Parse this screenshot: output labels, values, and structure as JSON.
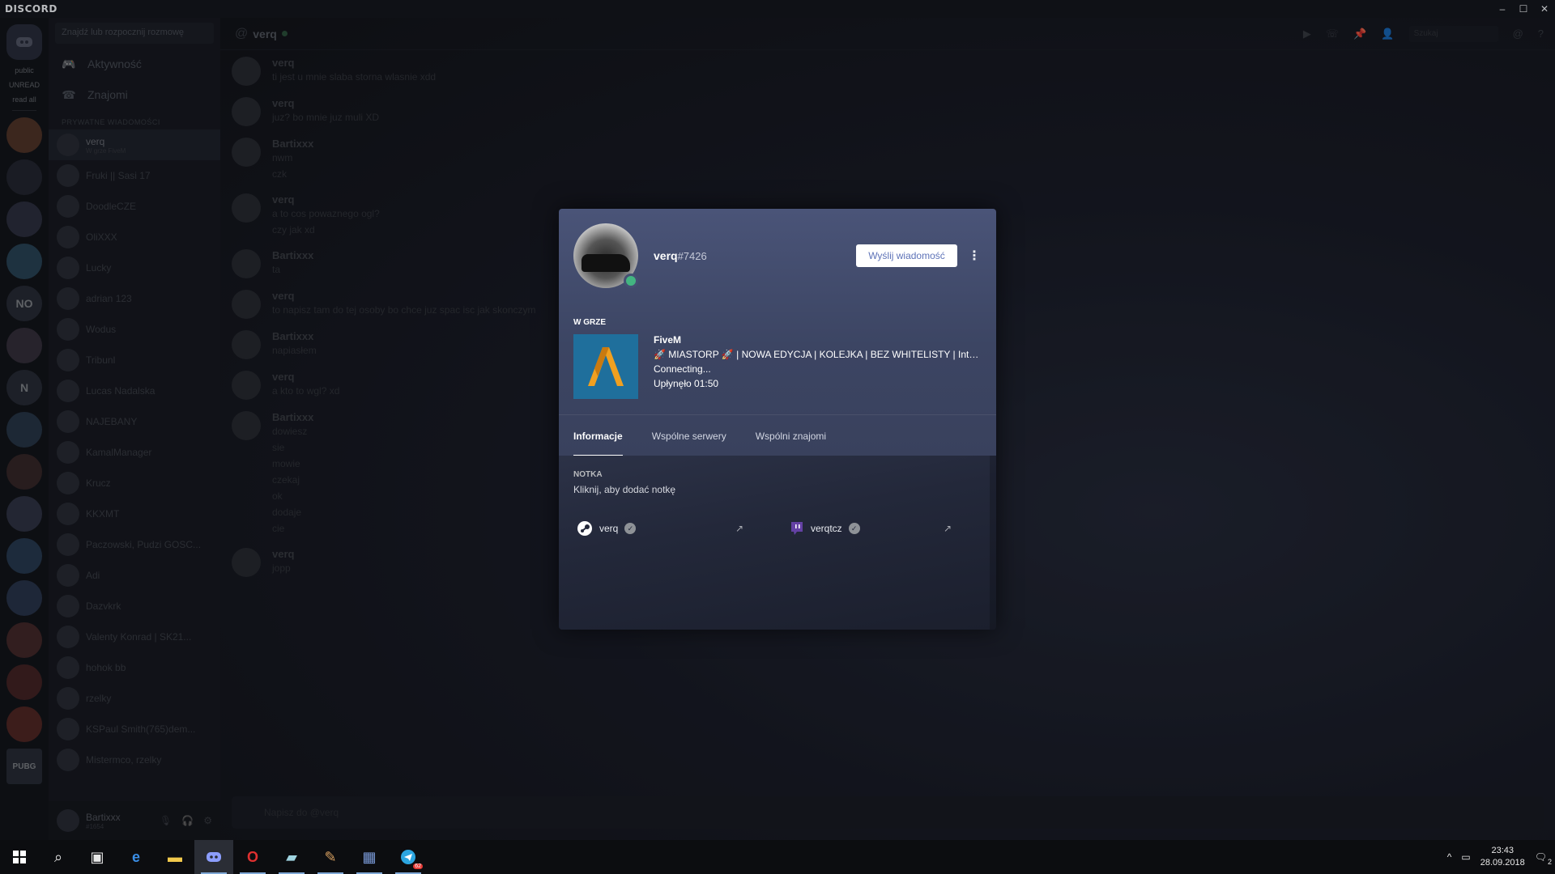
{
  "window": {
    "brand": "DISCORD",
    "controls": [
      "–",
      "☐",
      "✕"
    ]
  },
  "guilds": {
    "labels": {
      "public": "public",
      "unread": "UNREAD",
      "read_all": "read all"
    },
    "servers": [
      "NO",
      "N",
      "PUBG"
    ]
  },
  "dm_sidebar": {
    "search_placeholder": "Znajdź lub rozpocznij rozmowę",
    "nav": [
      {
        "label": "Aktywność",
        "icon": "gamepad-icon"
      },
      {
        "label": "Znajomi",
        "icon": "friends-icon"
      }
    ],
    "header": "PRYWATNE WIADOMOŚCI",
    "items": [
      {
        "name": "verq",
        "sub": "W grze FiveM"
      },
      {
        "name": "Fruki || Sasi 17",
        "sub": ""
      },
      {
        "name": "DoodleCZE",
        "sub": ""
      },
      {
        "name": "OliXXX",
        "sub": ""
      },
      {
        "name": "Lucky",
        "sub": ""
      },
      {
        "name": "adrian 123",
        "sub": ""
      },
      {
        "name": "Wodus",
        "sub": ""
      },
      {
        "name": "Tribunl",
        "sub": ""
      },
      {
        "name": "Lucas Nadalska",
        "sub": ""
      },
      {
        "name": "NAJEBANY",
        "sub": ""
      },
      {
        "name": "KamalManager",
        "sub": ""
      },
      {
        "name": "Krucz",
        "sub": ""
      },
      {
        "name": "KKXMT",
        "sub": ""
      },
      {
        "name": "Paczowski, Pudzi GOSC...",
        "sub": ""
      },
      {
        "name": "Adi",
        "sub": ""
      },
      {
        "name": "Dazvkrk",
        "sub": ""
      },
      {
        "name": "Valenty Konrad | SK21...",
        "sub": ""
      },
      {
        "name": "hohok bb",
        "sub": ""
      },
      {
        "name": "rzelky",
        "sub": ""
      },
      {
        "name": "KSPaul Smith(765)dem...",
        "sub": ""
      },
      {
        "name": "Mistermco, rzelky",
        "sub": ""
      }
    ],
    "user": {
      "name": "Bartixxx",
      "tag": "#1654"
    }
  },
  "chat": {
    "title": "verq",
    "search_placeholder": "Szukaj",
    "input_placeholder": "Napisz do @verq",
    "messages": [
      {
        "author": "verq",
        "lines": [
          "ti jest u mnie slaba storna wlasnie xdd"
        ]
      },
      {
        "author": "verq",
        "lines": [
          "juz? bo mnie juz muli XD"
        ]
      },
      {
        "author": "Bartixxx",
        "lines": [
          "nwm",
          "czk"
        ]
      },
      {
        "author": "verq",
        "lines": [
          "a to cos powaznego ogl?",
          "czy jak xd"
        ]
      },
      {
        "author": "Bartixxx",
        "lines": [
          "ta"
        ]
      },
      {
        "author": "verq",
        "lines": [
          "to napisz tam do tej osoby bo chce juz spac isc jak skonczym"
        ]
      },
      {
        "author": "Bartixxx",
        "lines": [
          "napiasłem"
        ]
      },
      {
        "author": "verq",
        "lines": [
          "a kto to wgl? xd"
        ]
      },
      {
        "author": "Bartixxx",
        "lines": [
          "dowiesz",
          "sie",
          "mowie",
          "czekaj",
          "ok",
          "dodaje",
          "cie"
        ]
      },
      {
        "author": "verq",
        "lines": [
          "jopp"
        ]
      }
    ]
  },
  "profile": {
    "username": "verq",
    "discriminator": "#7426",
    "status_color": "#43b581",
    "send_button": "Wyślij wiadomość",
    "more_icon": "⋮",
    "game_header": "W GRZE",
    "game": {
      "name": "FiveM",
      "details": "🚀 MIASTORP 🚀 | NOWA EDYCJA | KOLEJKA | BEZ WHITELISTY | Interi...",
      "state": "Connecting...",
      "elapsed": "Upłynęło 01:50"
    },
    "tabs": [
      "Informacje",
      "Wspólne serwery",
      "Wspólni znajomi"
    ],
    "note_header": "NOTKA",
    "note_placeholder": "Kliknij, aby dodać notkę",
    "accounts": [
      {
        "service": "steam-icon",
        "name": "verq",
        "verified": true
      },
      {
        "service": "twitch-icon",
        "name": "verqtcz",
        "verified": true
      }
    ]
  },
  "taskbar": {
    "time": "23:43",
    "date": "28.09.2018",
    "notification_count": "2",
    "telegram_badge": "62",
    "apps": [
      "start-icon",
      "search-icon",
      "task-view-icon",
      "edge-icon",
      "explorer-icon",
      "discord-icon",
      "opera-icon",
      "notepad-icon",
      "paint-icon",
      "network-icon",
      "telegram-icon"
    ]
  }
}
